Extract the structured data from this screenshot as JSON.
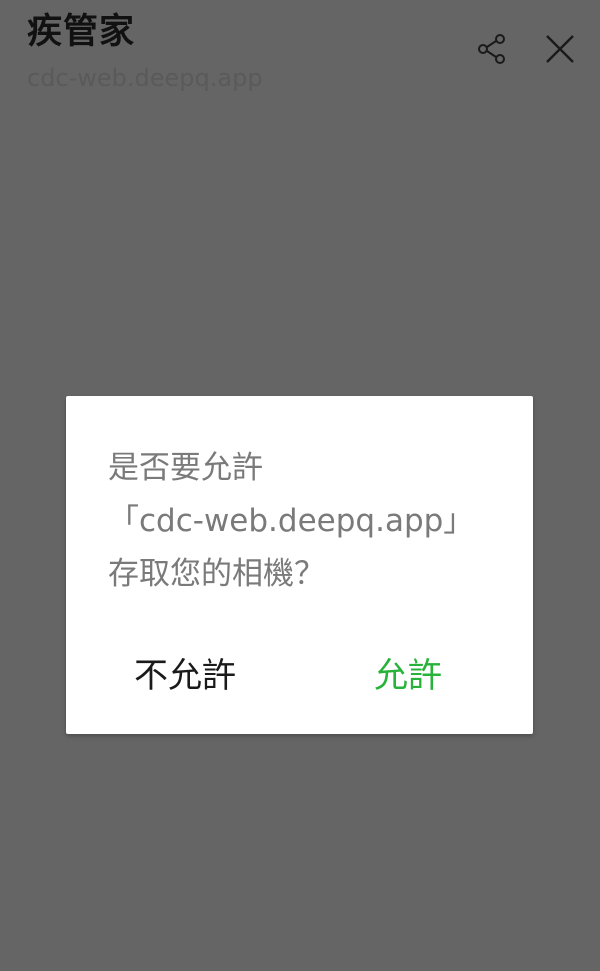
{
  "header": {
    "title": "疾管家",
    "url": "cdc-web.deepq.app",
    "share_icon": "share-icon",
    "close_icon": "close-icon"
  },
  "dialog": {
    "message_lines": [
      "是否要允許",
      "「cdc-web.deepq.app」",
      "存取您的相機？"
    ],
    "deny_label": "不允許",
    "allow_label": "允許"
  },
  "colors": {
    "overlay": "#656565",
    "allow": "#27b23a",
    "deny": "#1a1a1a",
    "message": "#7a7a7a"
  }
}
